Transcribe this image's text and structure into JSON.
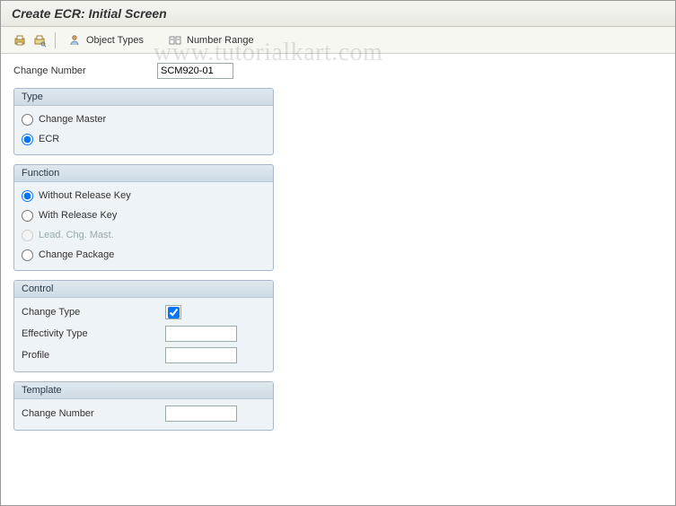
{
  "title": "Create ECR: Initial Screen",
  "toolbar": {
    "object_types_label": "Object Types",
    "number_range_label": "Number Range"
  },
  "top_field": {
    "label": "Change Number",
    "value": "SCM920-01"
  },
  "type_group": {
    "title": "Type",
    "options": {
      "change_master": "Change Master",
      "ecr": "ECR"
    },
    "selected": "ecr"
  },
  "function_group": {
    "title": "Function",
    "options": {
      "without_release_key": "Without Release Key",
      "with_release_key": "With Release Key",
      "lead_chg_mast": "Lead. Chg. Mast.",
      "change_package": "Change Package"
    },
    "selected": "without_release_key",
    "disabled": [
      "lead_chg_mast"
    ]
  },
  "control_group": {
    "title": "Control",
    "change_type_label": "Change Type",
    "change_type_checked": true,
    "effectivity_label": "Effectivity Type",
    "effectivity_value": "",
    "profile_label": "Profile",
    "profile_value": ""
  },
  "template_group": {
    "title": "Template",
    "change_number_label": "Change Number",
    "change_number_value": ""
  },
  "watermark": "www.tutorialkart.com"
}
